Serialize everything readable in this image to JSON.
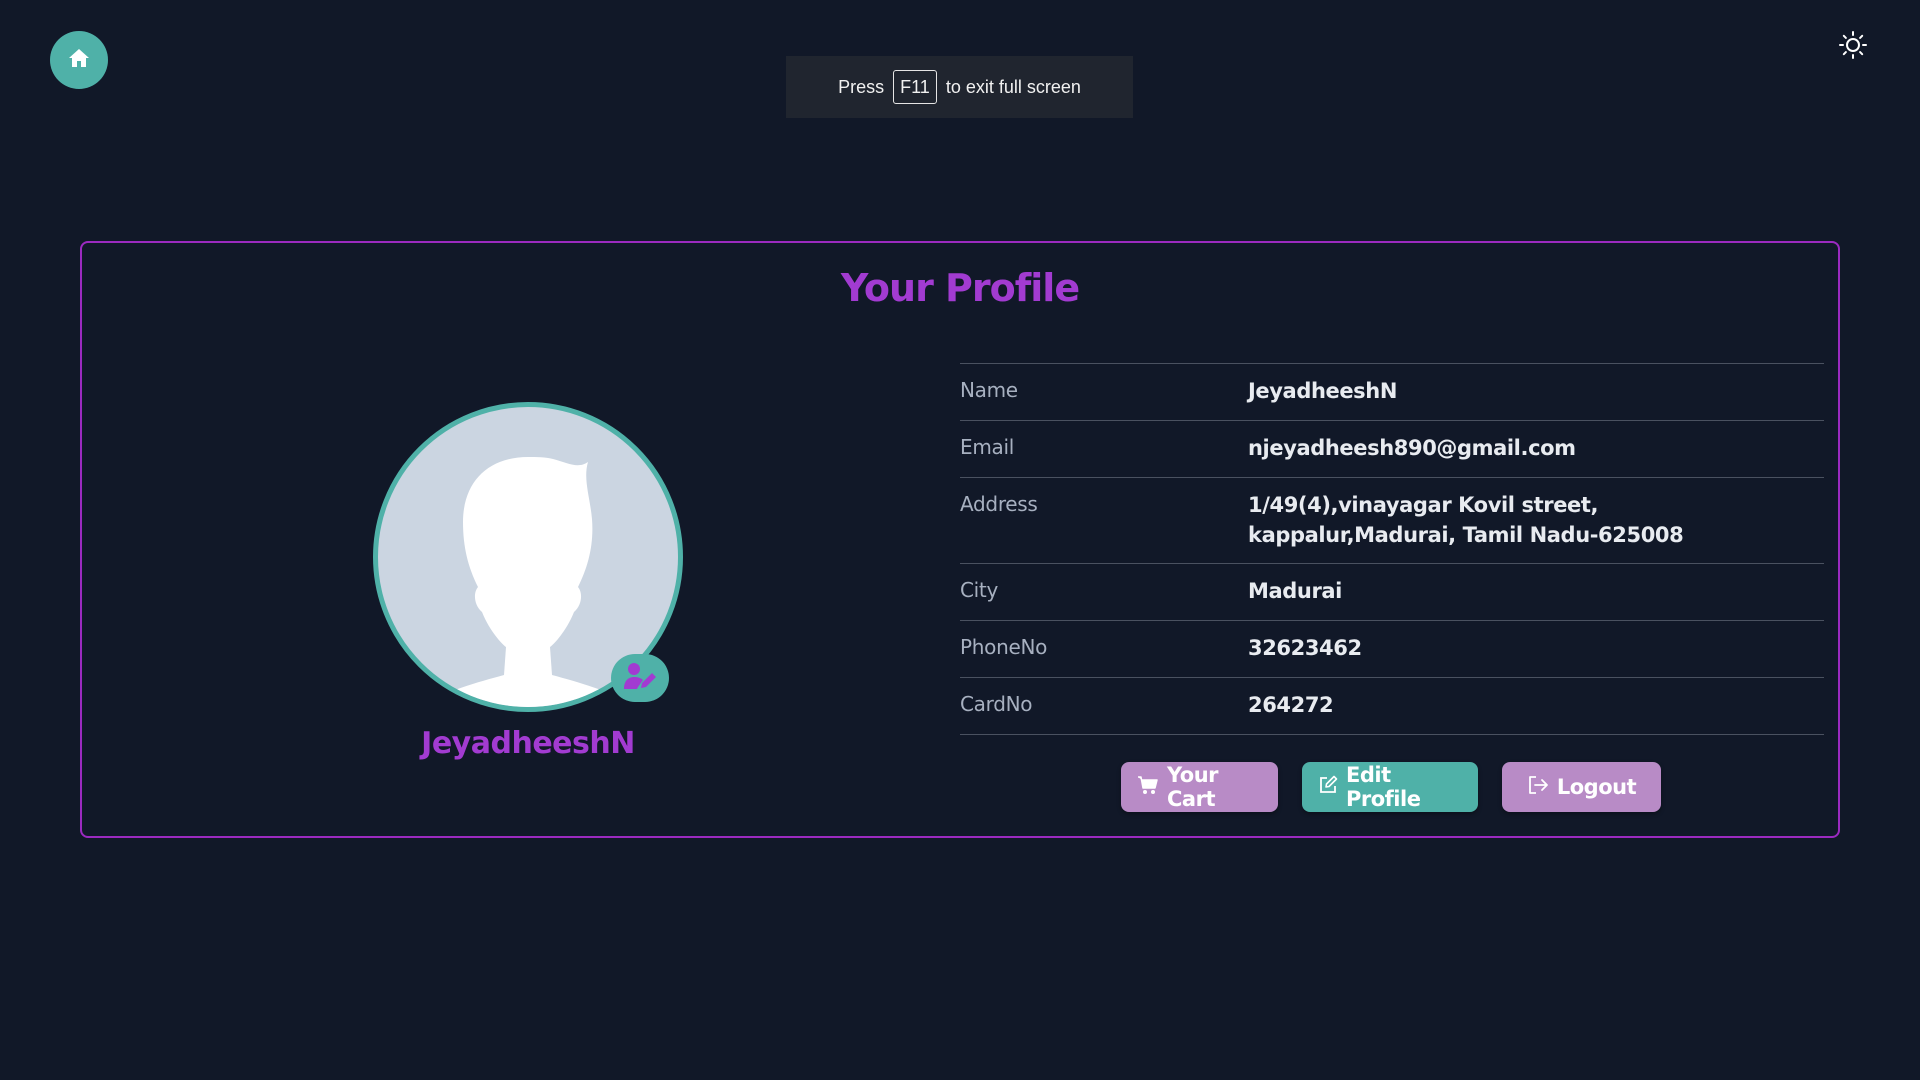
{
  "colors": {
    "background": "#111828",
    "accent_teal": "#4fb1a8",
    "accent_purple": "#a23bd1",
    "button_purple": "#b88bc6"
  },
  "header": {
    "home_icon": "home-icon",
    "theme_icon": "sun-icon"
  },
  "fullscreen_notice": {
    "prefix": "Press",
    "key": "F11",
    "suffix": "to exit full screen"
  },
  "profile": {
    "title": "Your Profile",
    "avatar_edit_icon": "user-edit-icon",
    "username": "JeyadheeshN",
    "fields": [
      {
        "label": "Name",
        "value": "JeyadheeshN"
      },
      {
        "label": "Email",
        "value": "njeyadheesh890@gmail.com"
      },
      {
        "label": "Address",
        "value": "1/49(4),vinayagar Kovil street, kappalur,Madurai, Tamil Nadu-625008"
      },
      {
        "label": "City",
        "value": "Madurai"
      },
      {
        "label": "PhoneNo",
        "value": "32623462"
      },
      {
        "label": "CardNo",
        "value": "264272"
      }
    ]
  },
  "actions": {
    "cart_label": "Your Cart",
    "cart_icon": "cart-icon",
    "edit_label": "Edit Profile",
    "edit_icon": "edit-icon",
    "logout_label": "Logout",
    "logout_icon": "logout-icon"
  }
}
